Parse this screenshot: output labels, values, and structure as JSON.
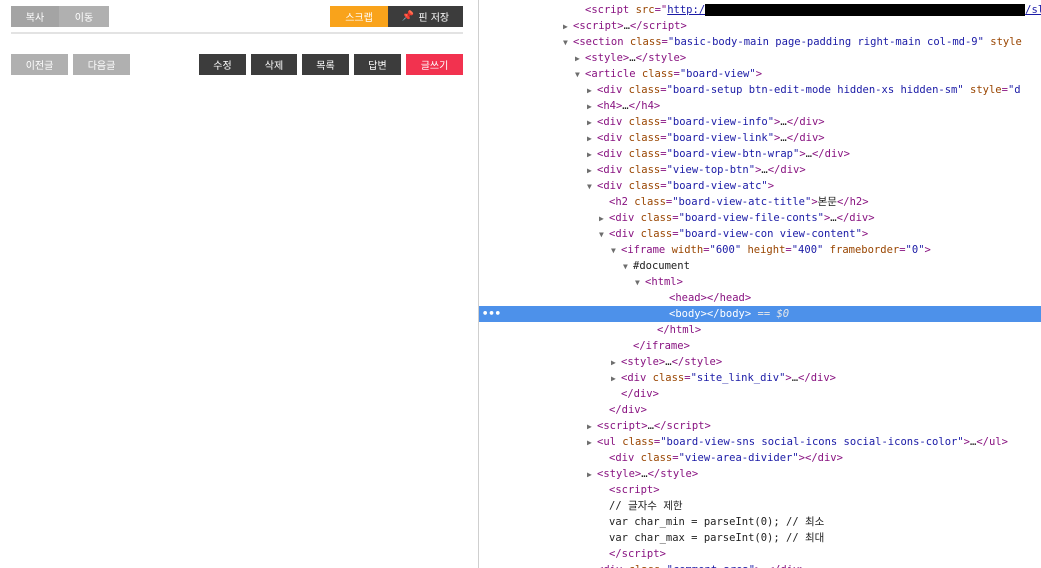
{
  "left": {
    "top_buttons": {
      "copy": "복사",
      "move": "이동",
      "scrap": "스크랩",
      "pin_save": "핀 저장"
    },
    "nav_buttons": {
      "prev": "이전글",
      "next": "다음글"
    },
    "action_buttons": {
      "edit": "수정",
      "delete": "삭제",
      "list": "목록",
      "reply": "답변",
      "write": "글쓰기"
    },
    "colors": {
      "orange": "#f9a31b",
      "red": "#f2324f",
      "dark": "#3c3c3c",
      "gray": "#b0b0b0"
    }
  },
  "devtools": {
    "selected_suffix": "== $0",
    "lines": [
      {
        "indent": 8,
        "tri": "",
        "html": "<span class='tag'>&lt;script</span> <span class='attr'>src</span><span class='tag'>=\"</span><span class='link'>http:/</span><span class='redact'></span><span class='link'>/sl</span>"
      },
      {
        "indent": 7,
        "tri": "▶",
        "html": "<span class='tag'>&lt;script&gt;</span><span class='txt'>…</span><span class='tag'>&lt;/script&gt;</span>"
      },
      {
        "indent": 7,
        "tri": "▼",
        "html": "<span class='tag'>&lt;section</span> <span class='attr'>class</span><span class='tag'>=</span><span class='val'>\"basic-body-main page-padding right-main col-md-9\"</span> <span class='attr'>style</span>"
      },
      {
        "indent": 8,
        "tri": "▶",
        "html": "<span class='tag'>&lt;style&gt;</span><span class='txt'>…</span><span class='tag'>&lt;/style&gt;</span>"
      },
      {
        "indent": 8,
        "tri": "▼",
        "html": "<span class='tag'>&lt;article</span> <span class='attr'>class</span><span class='tag'>=</span><span class='val'>\"board-view\"</span><span class='tag'>&gt;</span>"
      },
      {
        "indent": 9,
        "tri": "▶",
        "html": "<span class='tag'>&lt;div</span> <span class='attr'>class</span><span class='tag'>=</span><span class='val'>\"board-setup btn-edit-mode hidden-xs hidden-sm\"</span> <span class='attr'>style</span><span class='tag'>=</span><span class='val'>\"d</span>"
      },
      {
        "indent": 9,
        "tri": "▶",
        "html": "<span class='tag'>&lt;h4&gt;</span><span class='txt'>…</span><span class='tag'>&lt;/h4&gt;</span>"
      },
      {
        "indent": 9,
        "tri": "▶",
        "html": "<span class='tag'>&lt;div</span> <span class='attr'>class</span><span class='tag'>=</span><span class='val'>\"board-view-info\"</span><span class='tag'>&gt;</span><span class='txt'>…</span><span class='tag'>&lt;/div&gt;</span>"
      },
      {
        "indent": 9,
        "tri": "▶",
        "html": "<span class='tag'>&lt;div</span> <span class='attr'>class</span><span class='tag'>=</span><span class='val'>\"board-view-link\"</span><span class='tag'>&gt;</span><span class='txt'>…</span><span class='tag'>&lt;/div&gt;</span>"
      },
      {
        "indent": 9,
        "tri": "▶",
        "html": "<span class='tag'>&lt;div</span> <span class='attr'>class</span><span class='tag'>=</span><span class='val'>\"board-view-btn-wrap\"</span><span class='tag'>&gt;</span><span class='txt'>…</span><span class='tag'>&lt;/div&gt;</span>"
      },
      {
        "indent": 9,
        "tri": "▶",
        "html": "<span class='tag'>&lt;div</span> <span class='attr'>class</span><span class='tag'>=</span><span class='val'>\"view-top-btn\"</span><span class='tag'>&gt;</span><span class='txt'>…</span><span class='tag'>&lt;/div&gt;</span>"
      },
      {
        "indent": 9,
        "tri": "▼",
        "html": "<span class='tag'>&lt;div</span> <span class='attr'>class</span><span class='tag'>=</span><span class='val'>\"board-view-atc\"</span><span class='tag'>&gt;</span>"
      },
      {
        "indent": 10,
        "tri": "",
        "html": "<span class='tag'>&lt;h2</span> <span class='attr'>class</span><span class='tag'>=</span><span class='val'>\"board-view-atc-title\"</span><span class='tag'>&gt;</span><span class='txt'>본문</span><span class='tag'>&lt;/h2&gt;</span>"
      },
      {
        "indent": 10,
        "tri": "▶",
        "html": "<span class='tag'>&lt;div</span> <span class='attr'>class</span><span class='tag'>=</span><span class='val'>\"board-view-file-conts\"</span><span class='tag'>&gt;</span><span class='txt'>…</span><span class='tag'>&lt;/div&gt;</span>"
      },
      {
        "indent": 10,
        "tri": "▼",
        "html": "<span class='tag'>&lt;div</span> <span class='attr'>class</span><span class='tag'>=</span><span class='val'>\"board-view-con view-content\"</span><span class='tag'>&gt;</span>"
      },
      {
        "indent": 11,
        "tri": "▼",
        "html": "<span class='tag'>&lt;iframe</span> <span class='attr'>width</span><span class='tag'>=</span><span class='val'>\"600\"</span> <span class='attr'>height</span><span class='tag'>=</span><span class='val'>\"400\"</span> <span class='attr'>frameborder</span><span class='tag'>=</span><span class='val'>\"0\"</span><span class='tag'>&gt;</span>"
      },
      {
        "indent": 12,
        "tri": "▼",
        "html": "<span class='txt'>#document</span>"
      },
      {
        "indent": 13,
        "tri": "▼",
        "html": "<span class='tag'>&lt;html&gt;</span>"
      },
      {
        "indent": 15,
        "tri": "",
        "html": "<span class='tag'>&lt;head&gt;&lt;/head&gt;</span>"
      },
      {
        "indent": 15,
        "tri": "",
        "html": "<span class='tag'>&lt;body&gt;&lt;/body&gt;</span>",
        "selected": true
      },
      {
        "indent": 14,
        "tri": "",
        "html": "<span class='tag'>&lt;/html&gt;</span>"
      },
      {
        "indent": 12,
        "tri": "",
        "html": "<span class='tag'>&lt;/iframe&gt;</span>"
      },
      {
        "indent": 11,
        "tri": "▶",
        "html": "<span class='tag'>&lt;style&gt;</span><span class='txt'>…</span><span class='tag'>&lt;/style&gt;</span>"
      },
      {
        "indent": 11,
        "tri": "▶",
        "html": "<span class='tag'>&lt;div</span> <span class='attr'>class</span><span class='tag'>=</span><span class='val'>\"site_link_div\"</span><span class='tag'>&gt;</span><span class='txt'>…</span><span class='tag'>&lt;/div&gt;</span>"
      },
      {
        "indent": 11,
        "tri": "",
        "html": "<span class='tag'>&lt;/div&gt;</span>"
      },
      {
        "indent": 10,
        "tri": "",
        "html": "<span class='tag'>&lt;/div&gt;</span>"
      },
      {
        "indent": 9,
        "tri": "▶",
        "html": "<span class='tag'>&lt;script&gt;</span><span class='txt'>…</span><span class='tag'>&lt;/script&gt;</span>"
      },
      {
        "indent": 9,
        "tri": "▶",
        "html": "<span class='tag'>&lt;ul</span> <span class='attr'>class</span><span class='tag'>=</span><span class='val'>\"board-view-sns social-icons social-icons-color\"</span><span class='tag'>&gt;</span><span class='txt'>…</span><span class='tag'>&lt;/ul&gt;</span>"
      },
      {
        "indent": 10,
        "tri": "",
        "html": "<span class='tag'>&lt;div</span> <span class='attr'>class</span><span class='tag'>=</span><span class='val'>\"view-area-divider\"</span><span class='tag'>&gt;&lt;/div&gt;</span>"
      },
      {
        "indent": 9,
        "tri": "▶",
        "html": "<span class='tag'>&lt;style&gt;</span><span class='txt'>…</span><span class='tag'>&lt;/style&gt;</span>"
      },
      {
        "indent": 10,
        "tri": "",
        "html": "<span class='tag'>&lt;script&gt;</span>"
      },
      {
        "indent": 10,
        "tri": "",
        "html": "<span class='txt'>// 글자수 제한</span>"
      },
      {
        "indent": 10,
        "tri": "",
        "html": "<span class='txt'>var char_min = parseInt(0); // 최소</span>"
      },
      {
        "indent": 10,
        "tri": "",
        "html": "<span class='txt'>var char_max = parseInt(0); // 최대</span>"
      },
      {
        "indent": 10,
        "tri": "",
        "html": "<span class='tag'>&lt;/script&gt;</span>"
      },
      {
        "indent": 9,
        "tri": "▶",
        "html": "<span class='tag'>&lt;div</span> <span class='attr'>class</span><span class='tag'>=</span><span class='val'>\"comment-area\"</span><span class='tag'>&gt;</span><span class='txt'>…</span><span class='tag'>&lt;/div&gt;</span>"
      }
    ]
  }
}
